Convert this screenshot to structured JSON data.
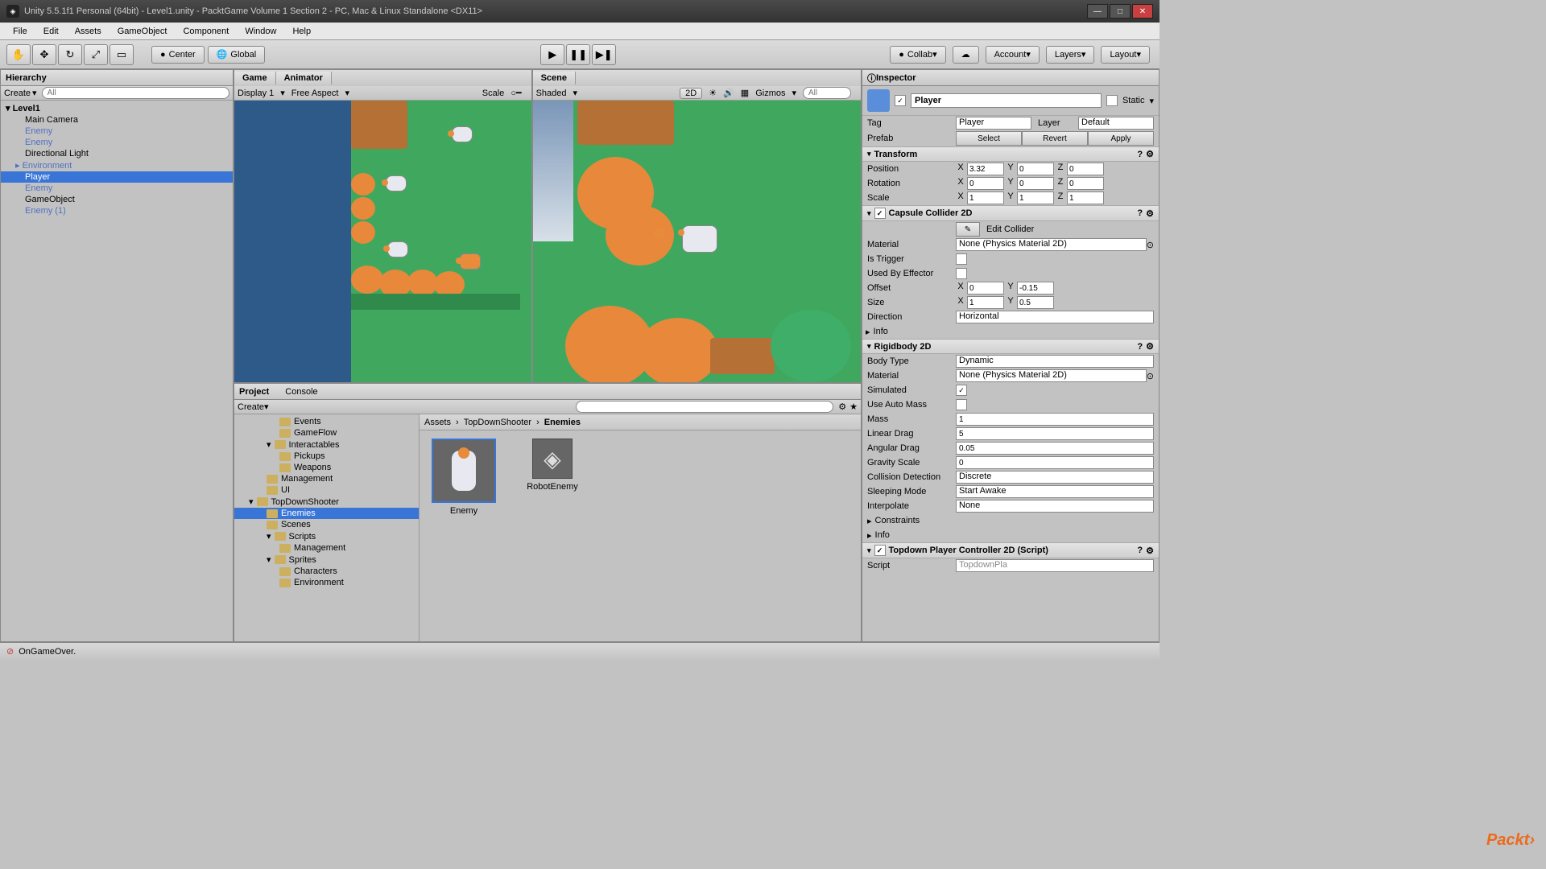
{
  "window": {
    "title": "Unity 5.5.1f1 Personal (64bit) - Level1.unity - PacktGame Volume 1 Section 2 - PC, Mac & Linux Standalone <DX11>"
  },
  "menu": {
    "items": [
      "File",
      "Edit",
      "Assets",
      "GameObject",
      "Component",
      "Window",
      "Help"
    ]
  },
  "toolbar": {
    "pivot": "Center",
    "space": "Global",
    "collab": "Collab",
    "account": "Account",
    "layers": "Layers",
    "layout": "Layout"
  },
  "hierarchy": {
    "tab": "Hierarchy",
    "create": "Create",
    "search_ph": "All",
    "root": "Level1",
    "items": [
      {
        "label": "Main Camera",
        "blue": false
      },
      {
        "label": "Enemy",
        "blue": true
      },
      {
        "label": "Enemy",
        "blue": true
      },
      {
        "label": "Directional Light",
        "blue": false
      },
      {
        "label": "Environment",
        "blue": true,
        "expand": true
      },
      {
        "label": "Player",
        "blue": true,
        "selected": true
      },
      {
        "label": "Enemy",
        "blue": true
      },
      {
        "label": "GameObject",
        "blue": false
      },
      {
        "label": "Enemy (1)",
        "blue": true
      }
    ]
  },
  "game": {
    "tab1": "Game",
    "tab2": "Animator",
    "display": "Display 1",
    "aspect": "Free Aspect",
    "scale": "Scale"
  },
  "scene": {
    "tab": "Scene",
    "shading": "Shaded",
    "mode": "2D",
    "gizmos": "Gizmos",
    "search_ph": "All"
  },
  "project": {
    "tab1": "Project",
    "tab2": "Console",
    "create": "Create",
    "folders": [
      {
        "label": "Events",
        "depth": 2
      },
      {
        "label": "GameFlow",
        "depth": 2
      },
      {
        "label": "Interactables",
        "depth": 1,
        "expand": true
      },
      {
        "label": "Pickups",
        "depth": 2
      },
      {
        "label": "Weapons",
        "depth": 2
      },
      {
        "label": "Management",
        "depth": 1
      },
      {
        "label": "UI",
        "depth": 1
      },
      {
        "label": "TopDownShooter",
        "depth": 0,
        "expand": true
      },
      {
        "label": "Enemies",
        "depth": 1,
        "selected": true
      },
      {
        "label": "Scenes",
        "depth": 1
      },
      {
        "label": "Scripts",
        "depth": 1,
        "expand": true
      },
      {
        "label": "Management",
        "depth": 2
      },
      {
        "label": "Sprites",
        "depth": 1,
        "expand": true
      },
      {
        "label": "Characters",
        "depth": 2
      },
      {
        "label": "Environment",
        "depth": 2
      }
    ],
    "breadcrumb": [
      "Assets",
      "TopDownShooter",
      "Enemies"
    ],
    "assets": [
      {
        "name": "Enemy",
        "selected": true
      },
      {
        "name": "RobotEnemy",
        "selected": false
      }
    ]
  },
  "inspector": {
    "tab": "Inspector",
    "name": "Player",
    "static": "Static",
    "tag_label": "Tag",
    "tag": "Player",
    "layer_label": "Layer",
    "layer": "Default",
    "prefab_label": "Prefab",
    "prefab_btns": [
      "Select",
      "Revert",
      "Apply"
    ],
    "transform": {
      "title": "Transform",
      "position": "Position",
      "rotation": "Rotation",
      "scale": "Scale",
      "pos": {
        "x": "3.32",
        "y": "0",
        "z": "0"
      },
      "rot": {
        "x": "0",
        "y": "0",
        "z": "0"
      },
      "scl": {
        "x": "1",
        "y": "1",
        "z": "1"
      }
    },
    "capsule": {
      "title": "Capsule Collider 2D",
      "edit_btn": "Edit Collider",
      "material_label": "Material",
      "material": "None (Physics Material 2D)",
      "trigger_label": "Is Trigger",
      "effector_label": "Used By Effector",
      "offset_label": "Offset",
      "offset": {
        "x": "0",
        "y": "-0.15"
      },
      "size_label": "Size",
      "size": {
        "x": "1",
        "y": "0.5"
      },
      "direction_label": "Direction",
      "direction": "Horizontal",
      "info_label": "Info"
    },
    "rb": {
      "title": "Rigidbody 2D",
      "body_type_label": "Body Type",
      "body_type": "Dynamic",
      "material_label": "Material",
      "material": "None (Physics Material 2D)",
      "simulated_label": "Simulated",
      "simulated": true,
      "auto_mass_label": "Use Auto Mass",
      "mass_label": "Mass",
      "mass": "1",
      "linear_drag_label": "Linear Drag",
      "linear_drag": "5",
      "angular_drag_label": "Angular Drag",
      "angular_drag": "0.05",
      "gravity_label": "Gravity Scale",
      "gravity": "0",
      "collision_label": "Collision Detection",
      "collision": "Discrete",
      "sleep_label": "Sleeping Mode",
      "sleep": "Start Awake",
      "interp_label": "Interpolate",
      "interp": "None",
      "constraints_label": "Constraints",
      "info_label": "Info"
    },
    "script": {
      "title": "Topdown Player Controller 2D (Script)",
      "script_label": "Script",
      "script": "TopdownPla"
    }
  },
  "statusbar": {
    "msg": "OnGameOver."
  }
}
